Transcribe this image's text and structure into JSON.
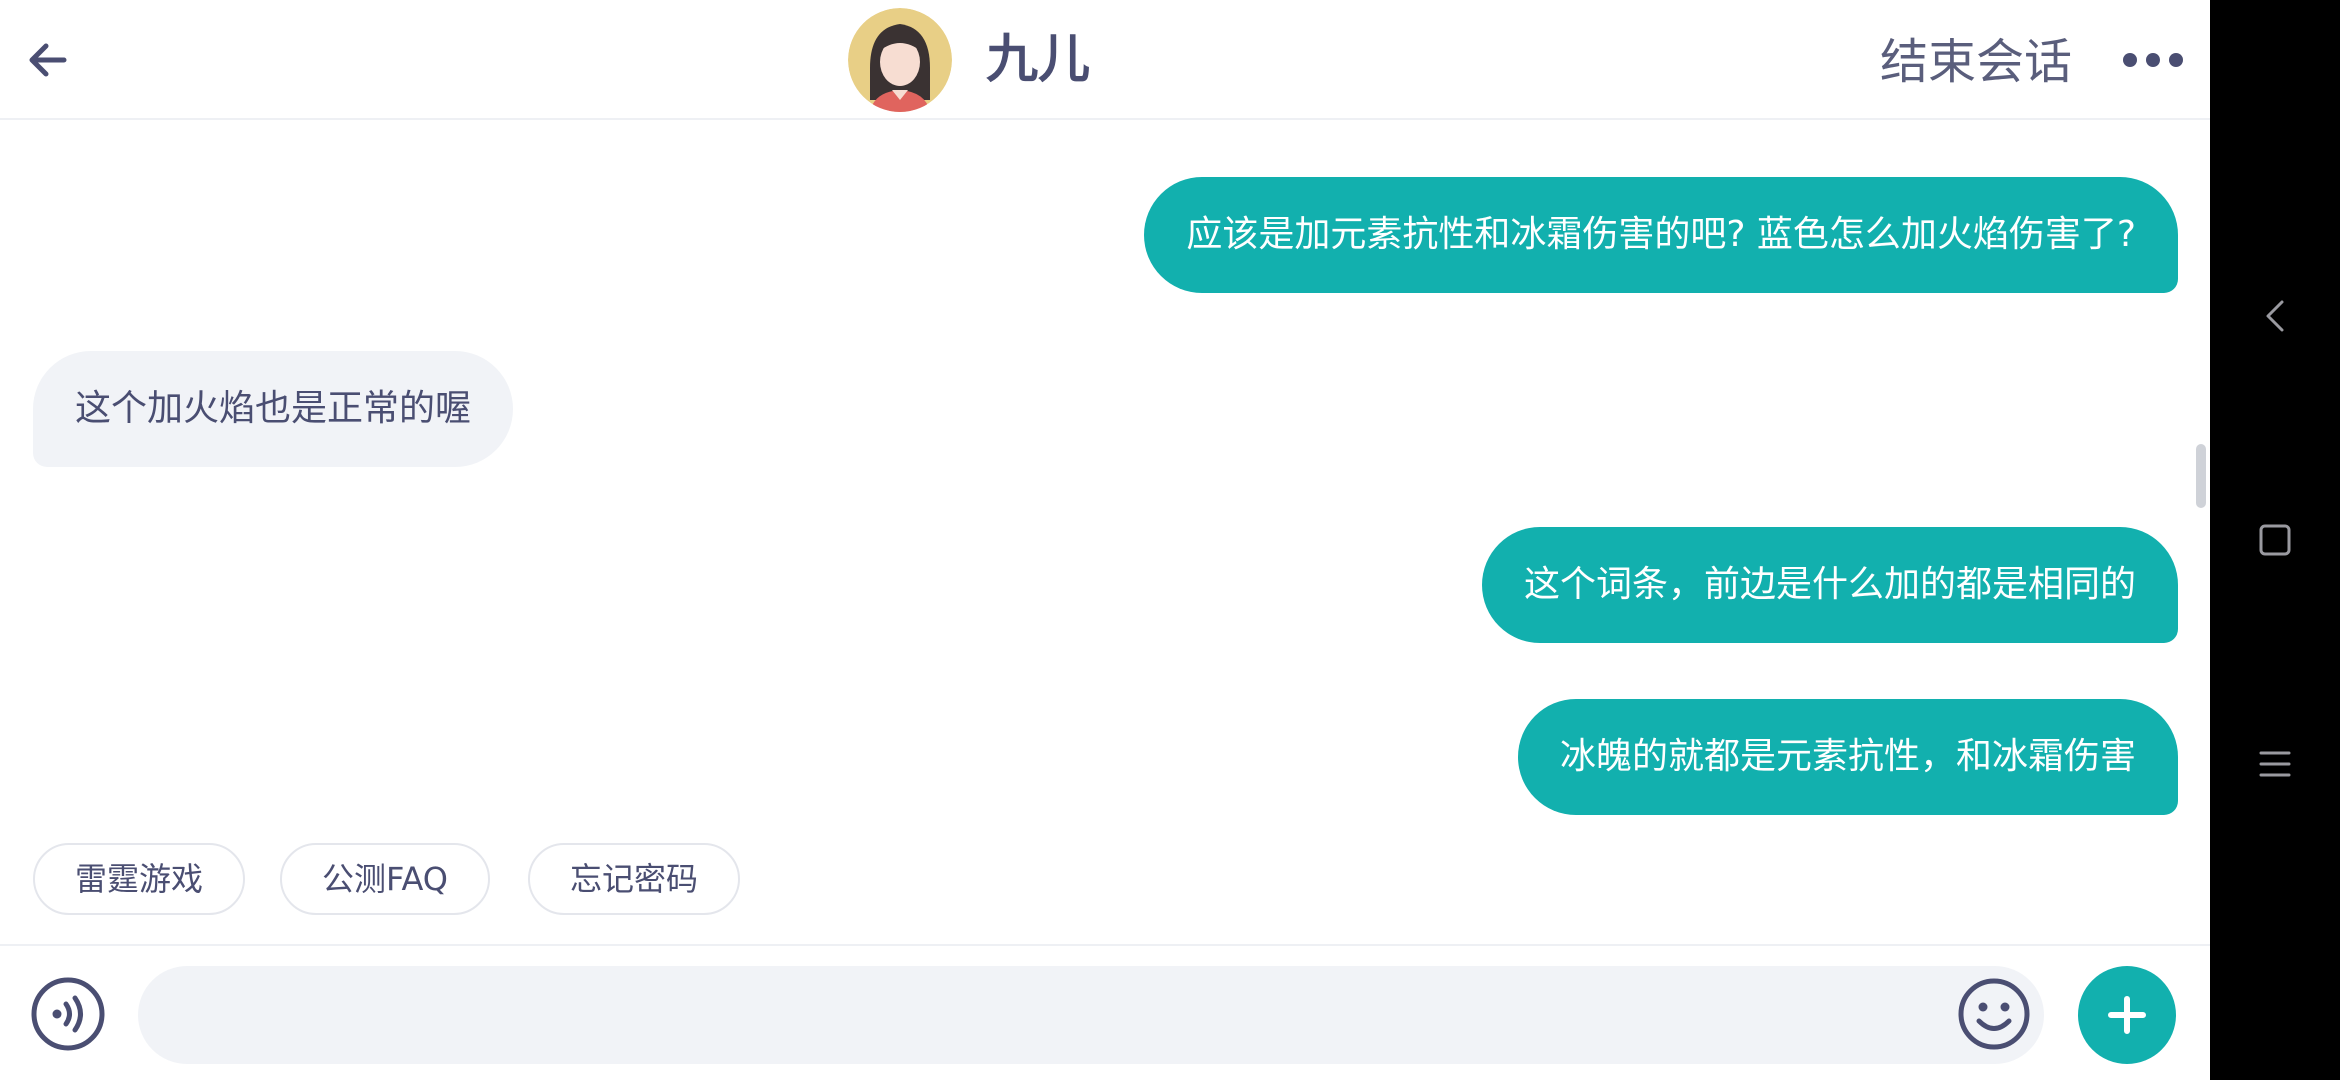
{
  "header": {
    "title": "九儿",
    "end_session_label": "结束会话"
  },
  "messages": [
    {
      "side": "out",
      "text": "应该是加元素抗性和冰霜伤害的吧? 蓝色怎么加火焰伤害了?"
    },
    {
      "side": "in",
      "text": "这个加火焰也是正常的喔"
    },
    {
      "side": "out",
      "text": "这个词条，前边是什么加的都是相同的"
    },
    {
      "side": "out",
      "text": "冰魄的就都是元素抗性，和冰霜伤害"
    }
  ],
  "quick_replies": [
    "雷霆游戏",
    "公测FAQ",
    "忘记密码"
  ],
  "input": {
    "value": "",
    "placeholder": ""
  },
  "colors": {
    "accent": "#12b0ae",
    "bubble_in": "#f1f3f7",
    "text_dark": "#4a4e72"
  },
  "icons": {
    "back": "arrow-left-icon",
    "more": "more-dots-icon",
    "voice": "voice-icon",
    "emoji": "emoji-icon",
    "plus": "plus-icon"
  }
}
